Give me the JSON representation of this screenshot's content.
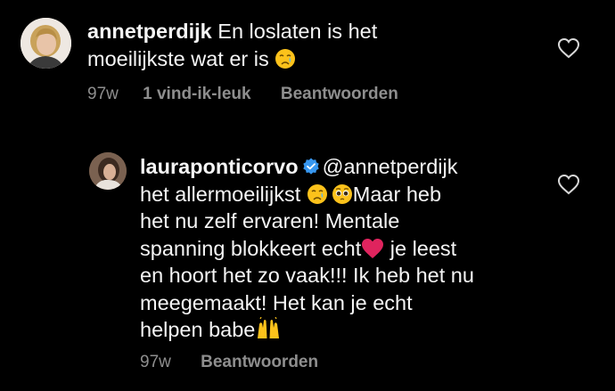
{
  "comments": [
    {
      "username": "annetperdijk",
      "text_line1": "En loslaten is het",
      "text_line2": "moeilijkste  wat er is",
      "time": "97w",
      "likes": "1 vind-ik-leuk",
      "reply": "Beantwoorden"
    },
    {
      "username": "lauraponticorvo",
      "mention": "@annetperdijk",
      "line2a": "het allermoeilijkst ",
      "line2b": "Maar heb",
      "line3": "het nu zelf ervaren! Mentale",
      "line4a": "spanning blokkeert echt",
      "line4b": " je leest",
      "line5": "en hoort het zo vaak!!! Ik heb het nu",
      "line6": "meegemaakt! Het kan je echt",
      "line7": "helpen babe",
      "time": "97w",
      "reply": "Beantwoorden"
    }
  ],
  "icons": {
    "heart": "heart-outline-icon",
    "verified": "verified-badge-icon",
    "crying": "crying-face-emoji",
    "pleading": "pleading-face-emoji",
    "red_heart": "red-heart-emoji",
    "raising_hands": "raising-hands-emoji"
  },
  "colors": {
    "background": "#000000",
    "text": "#f5f5f5",
    "meta": "#8e8e8e",
    "verified": "#3797f0",
    "red_heart": "#e0245e"
  }
}
